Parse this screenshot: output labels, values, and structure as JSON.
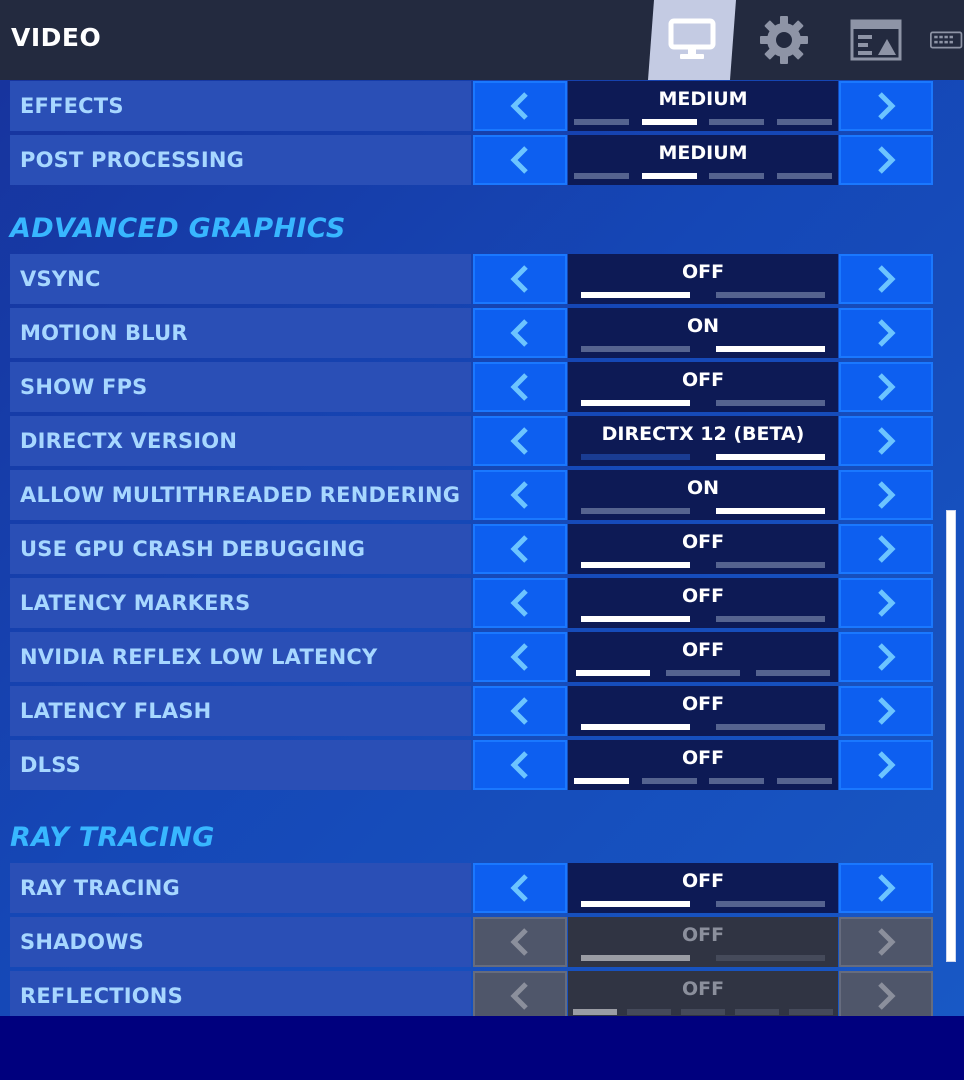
{
  "header": {
    "title": "VIDEO",
    "tabs": [
      {
        "name": "monitor-icon",
        "active": true
      },
      {
        "name": "gear-icon",
        "active": false
      },
      {
        "name": "hud-layout-icon",
        "active": false
      },
      {
        "name": "keyboard-icon",
        "active": false
      }
    ]
  },
  "colors": {
    "accent": "#0d5ff0",
    "section_heading": "#38b7ff",
    "label_text": "#a7d7ff",
    "topbar": "#232a3f",
    "footer": "#00007e"
  },
  "rows_top": [
    {
      "label": "EFFECTS",
      "value": "MEDIUM",
      "steps": 4,
      "selected": 1
    },
    {
      "label": "POST PROCESSING",
      "value": "MEDIUM",
      "steps": 4,
      "selected": 1
    }
  ],
  "sections": [
    {
      "heading": "ADVANCED GRAPHICS",
      "rows": [
        {
          "label": "VSYNC",
          "value": "OFF",
          "steps": 2,
          "selected": 0
        },
        {
          "label": "MOTION BLUR",
          "value": "ON",
          "steps": 2,
          "selected": 1
        },
        {
          "label": "SHOW FPS",
          "value": "OFF",
          "steps": 2,
          "selected": 0
        },
        {
          "label": "DIRECTX VERSION",
          "value": "DIRECTX 12 (BETA)",
          "steps": 2,
          "selected": 1
        },
        {
          "label": "ALLOW MULTITHREADED RENDERING",
          "value": "ON",
          "steps": 2,
          "selected": 1
        },
        {
          "label": "USE GPU CRASH DEBUGGING",
          "value": "OFF",
          "steps": 2,
          "selected": 0
        },
        {
          "label": "LATENCY MARKERS",
          "value": "OFF",
          "steps": 2,
          "selected": 0
        },
        {
          "label": "NVIDIA REFLEX LOW LATENCY",
          "value": "OFF",
          "steps": 3,
          "selected": 0
        },
        {
          "label": "LATENCY FLASH",
          "value": "OFF",
          "steps": 2,
          "selected": 0
        },
        {
          "label": "DLSS",
          "value": "OFF",
          "steps": 4,
          "selected": 0
        }
      ]
    },
    {
      "heading": "RAY TRACING",
      "rows": [
        {
          "label": "RAY TRACING",
          "value": "OFF",
          "steps": 2,
          "selected": 0
        },
        {
          "label": "SHADOWS",
          "value": "OFF",
          "steps": 2,
          "selected": 0,
          "disabled": true
        },
        {
          "label": "REFLECTIONS",
          "value": "OFF",
          "steps": 5,
          "selected": 0,
          "disabled": true
        }
      ]
    }
  ]
}
